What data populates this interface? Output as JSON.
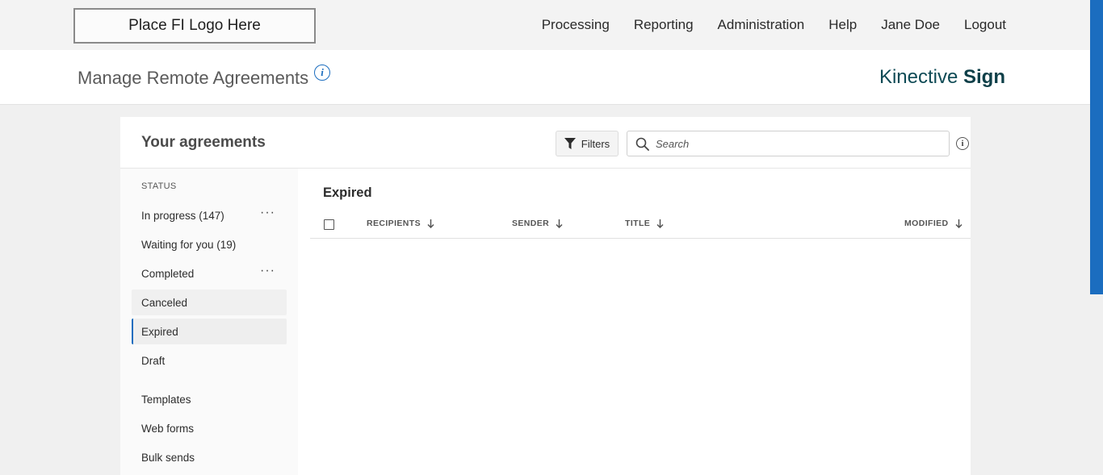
{
  "topbar": {
    "logo_text": "Place FI Logo Here",
    "nav": [
      "Processing",
      "Reporting",
      "Administration",
      "Help",
      "Jane Doe",
      "Logout"
    ]
  },
  "header": {
    "page_title": "Manage Remote Agreements",
    "info_icon": "i",
    "brand_regular": "Kinective",
    "brand_bold": "Sign"
  },
  "panel": {
    "title": "Your agreements",
    "filters_label": "Filters",
    "search_placeholder": "Search",
    "info_icon": "i"
  },
  "sidebar": {
    "status_label": "STATUS",
    "items": [
      {
        "label": "In progress (147)",
        "menu": "···"
      },
      {
        "label": "Waiting for you (19)"
      },
      {
        "label": "Completed",
        "menu": "···"
      },
      {
        "label": "Canceled"
      },
      {
        "label": "Expired"
      },
      {
        "label": "Draft"
      },
      {
        "label": "Templates"
      },
      {
        "label": "Web forms"
      },
      {
        "label": "Bulk sends"
      }
    ]
  },
  "content": {
    "title": "Expired",
    "columns": [
      "RECIPIENTS",
      "SENDER",
      "TITLE",
      "MODIFIED"
    ]
  },
  "colors": {
    "accent": "#1b6dbf",
    "brand": "#0e4a55"
  }
}
